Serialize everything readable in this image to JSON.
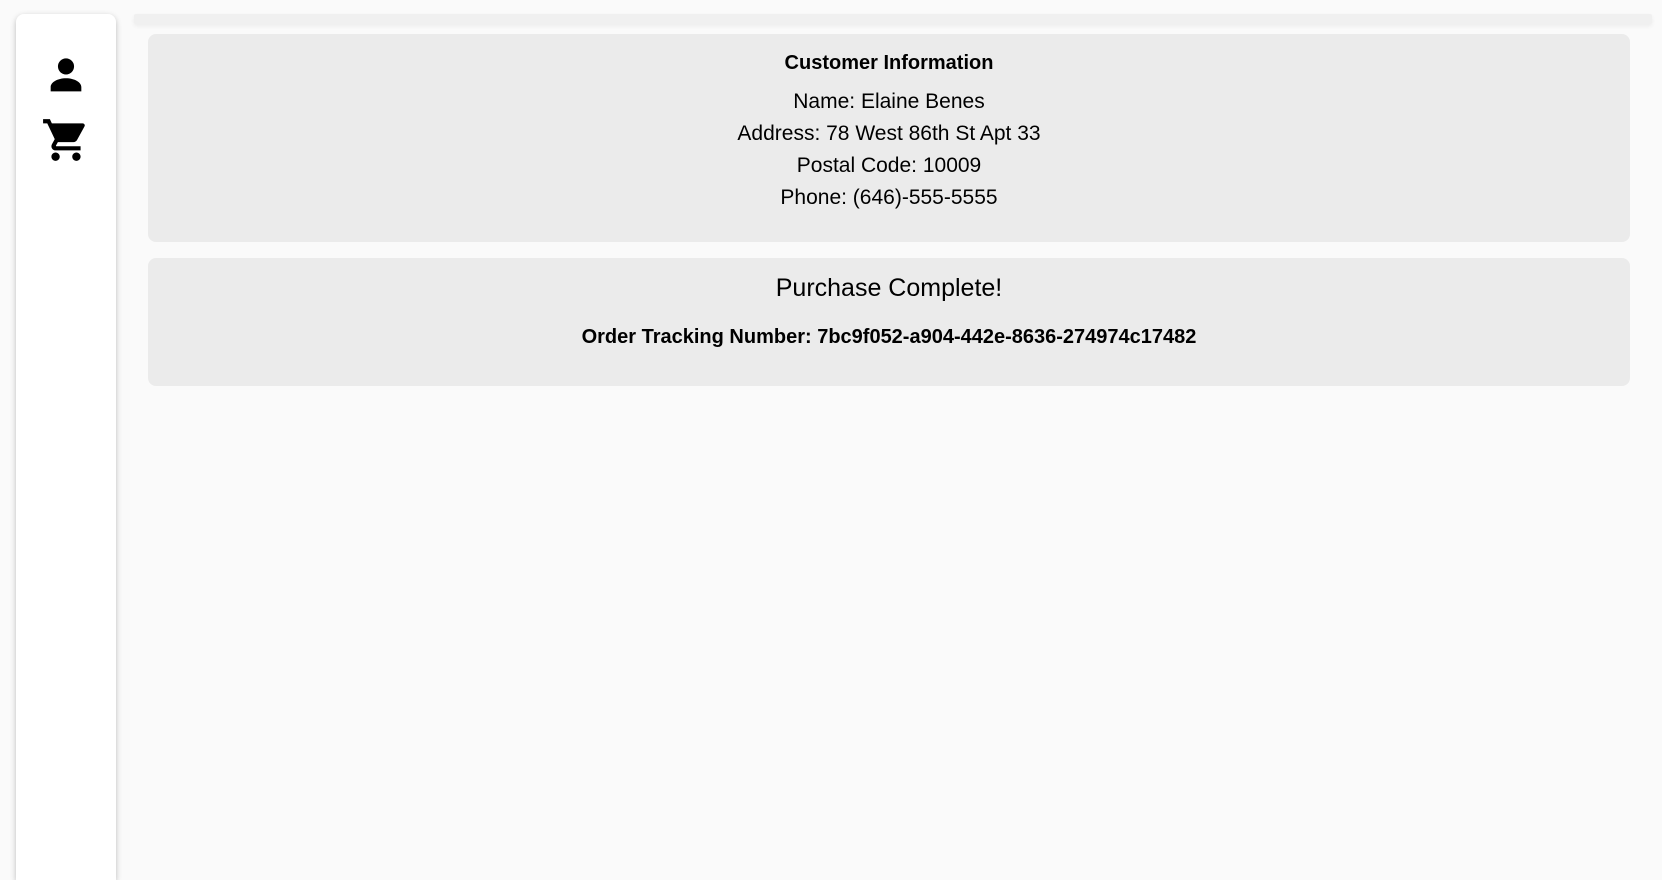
{
  "sidebar": {
    "items": [
      {
        "icon": "person-icon"
      },
      {
        "icon": "shopping-cart-icon"
      }
    ]
  },
  "customer": {
    "heading": "Customer Information",
    "name": "Name: Elaine Benes",
    "address": "Address: 78 West 86th St Apt 33",
    "postal_code": "Postal Code: 10009",
    "phone": "Phone: (646)-555-5555"
  },
  "purchase": {
    "heading": "Purchase Complete!",
    "tracking": "Order Tracking Number: 7bc9f052-a904-442e-8636-274974c17482"
  }
}
